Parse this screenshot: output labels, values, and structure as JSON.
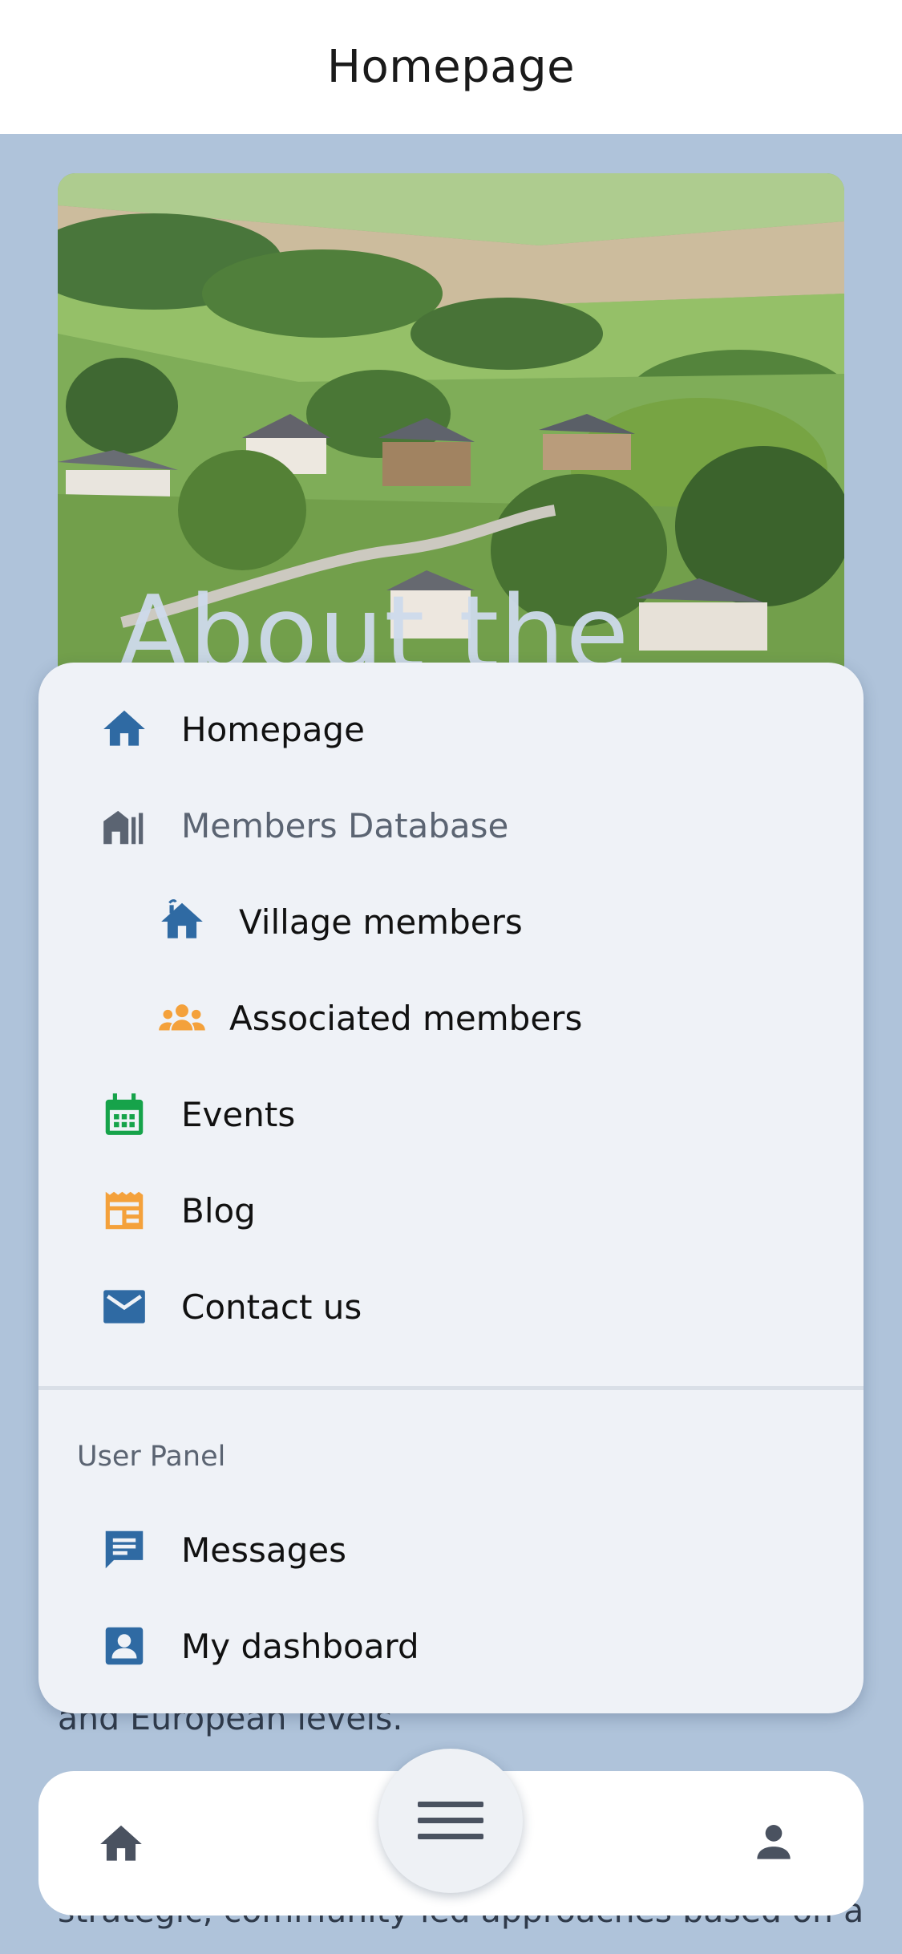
{
  "header": {
    "title": "Homepage"
  },
  "hero": {
    "overlay_title": "About the"
  },
  "background_text": {
    "line_a": "and European levels.",
    "line_b": "strategic, community-led approaches based on a"
  },
  "menu": {
    "items": [
      {
        "label": "Homepage",
        "icon": "home-icon",
        "color": "#2f6aa3"
      },
      {
        "label": "Members Database",
        "icon": "buildings-icon",
        "color": "#5b6472"
      },
      {
        "label": "Village members",
        "icon": "house-icon",
        "color": "#2f6aa3"
      },
      {
        "label": "Associated members",
        "icon": "group-icon",
        "color": "#f4a13b"
      },
      {
        "label": "Events",
        "icon": "calendar-icon",
        "color": "#16a34a"
      },
      {
        "label": "Blog",
        "icon": "newspaper-icon",
        "color": "#f4a13b"
      },
      {
        "label": "Contact us",
        "icon": "envelope-icon",
        "color": "#2f6aa3"
      }
    ],
    "section_label": "User Panel",
    "user_items": [
      {
        "label": "Messages",
        "icon": "chat-icon",
        "color": "#2f6aa3"
      },
      {
        "label": "My dashboard",
        "icon": "profile-card-icon",
        "color": "#2f6aa3"
      }
    ]
  },
  "bottom_nav": {
    "home_icon": "home-icon",
    "menu_icon": "hamburger-icon",
    "profile_icon": "person-icon"
  },
  "colors": {
    "page_background": "#afc3da",
    "menu_background": "#eff2f7",
    "accent_blue": "#2f6aa3",
    "accent_orange": "#f4a13b",
    "accent_green": "#16a34a"
  }
}
